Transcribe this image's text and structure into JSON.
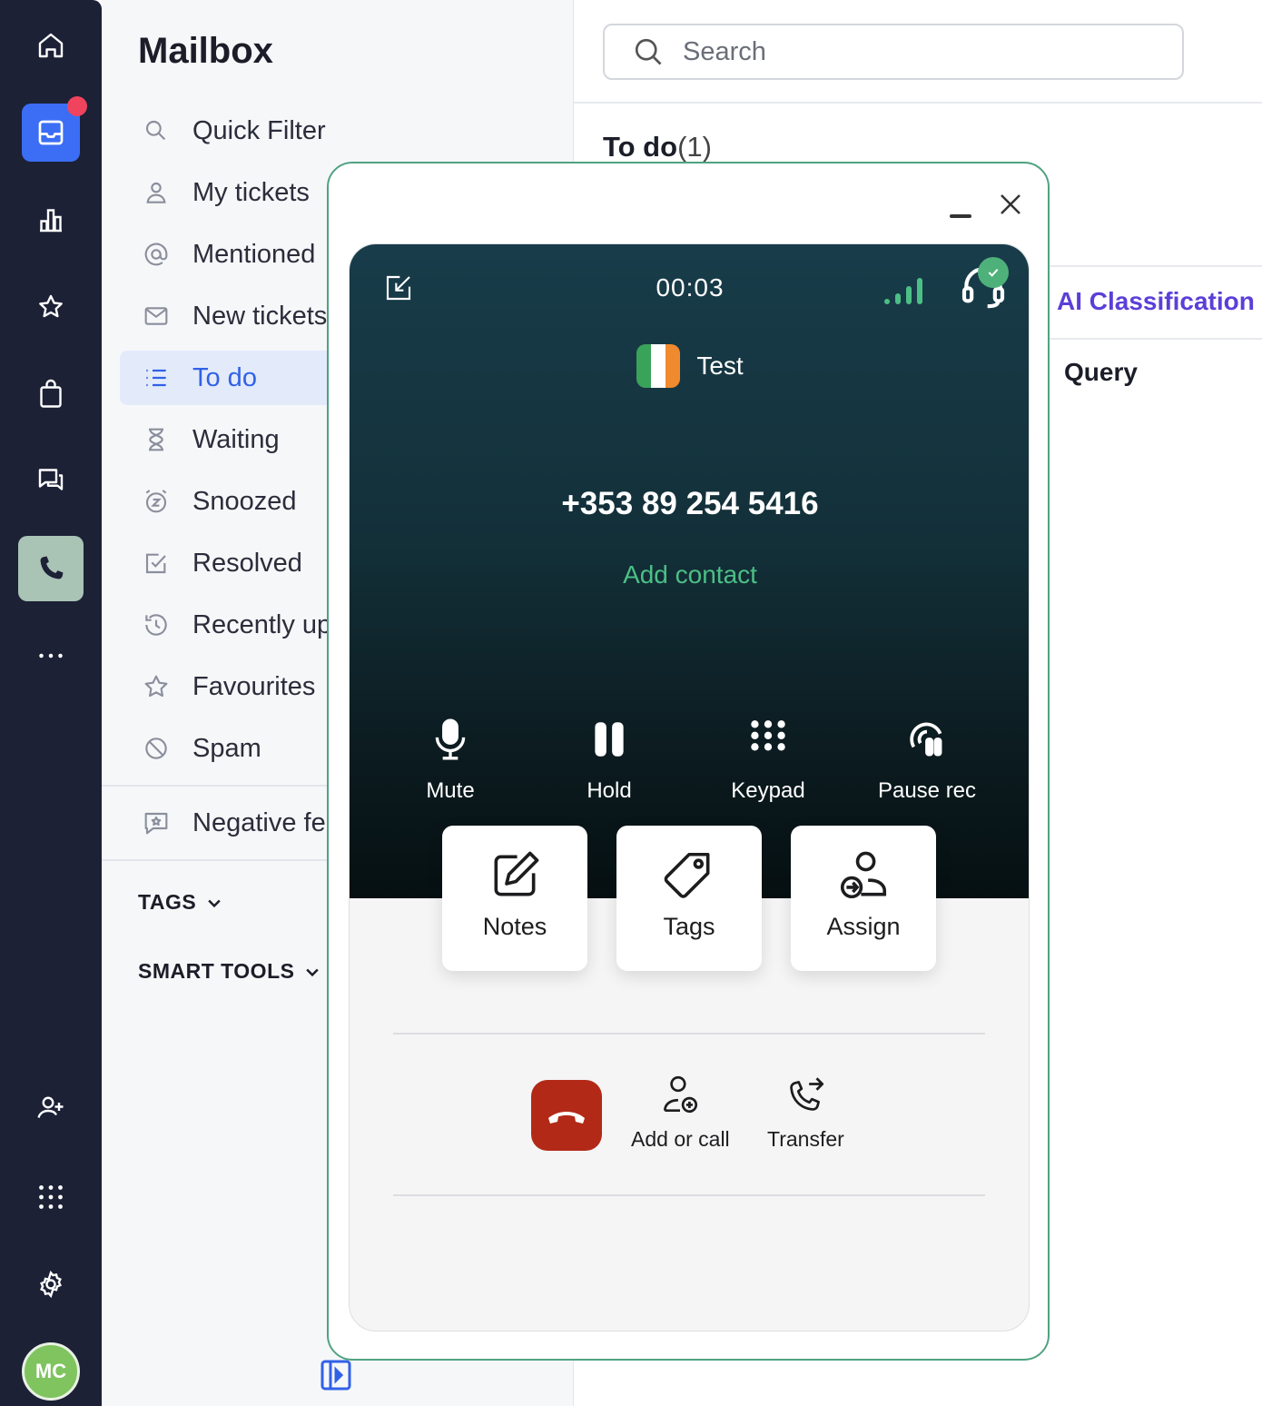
{
  "rail": {
    "icons": [
      "home-icon",
      "inbox-icon",
      "chart-icon",
      "star-icon",
      "bag-icon",
      "chat-icon",
      "phone-icon",
      "more-icon",
      "add-user-icon",
      "apps-grid-icon",
      "settings-icon"
    ],
    "avatar_initials": "MC",
    "notification_color": "#f0435e",
    "accent": "#3b6ef5"
  },
  "mailbox": {
    "title": "Mailbox",
    "items": [
      {
        "label": "Quick Filter",
        "icon": "search-icon"
      },
      {
        "label": "My tickets",
        "icon": "user-icon"
      },
      {
        "label": "Mentioned",
        "icon": "at-icon"
      },
      {
        "label": "New tickets",
        "icon": "envelope-icon"
      },
      {
        "label": "To do",
        "icon": "list-icon"
      },
      {
        "label": "Waiting",
        "icon": "hourglass-icon"
      },
      {
        "label": "Snoozed",
        "icon": "alarm-icon"
      },
      {
        "label": "Resolved",
        "icon": "check-square-icon"
      },
      {
        "label": "Recently up",
        "icon": "history-icon"
      },
      {
        "label": "Favourites",
        "icon": "star-icon"
      },
      {
        "label": "Spam",
        "icon": "block-icon"
      },
      {
        "label": "Negative fe",
        "icon": "feedback-icon"
      }
    ],
    "active_item": "To do",
    "tags_label": "TAGS",
    "smart_tools_label": "SMART TOOLS"
  },
  "main": {
    "search_placeholder": "Search",
    "list_title": "To do",
    "list_count": "(1)",
    "ai_classification": "AI Classification",
    "query_label": "Query"
  },
  "call": {
    "timer": "00:03",
    "contact_name": "Test",
    "phone_number": "+353 89 254 5416",
    "add_contact": "Add contact",
    "controls": [
      "Mute",
      "Hold",
      "Keypad",
      "Pause rec"
    ],
    "actions": [
      "Notes",
      "Tags",
      "Assign"
    ],
    "bottom_actions": [
      "Add or call",
      "Transfer"
    ],
    "hangup_color": "#b22a17",
    "accent_green": "#4cbf86"
  }
}
